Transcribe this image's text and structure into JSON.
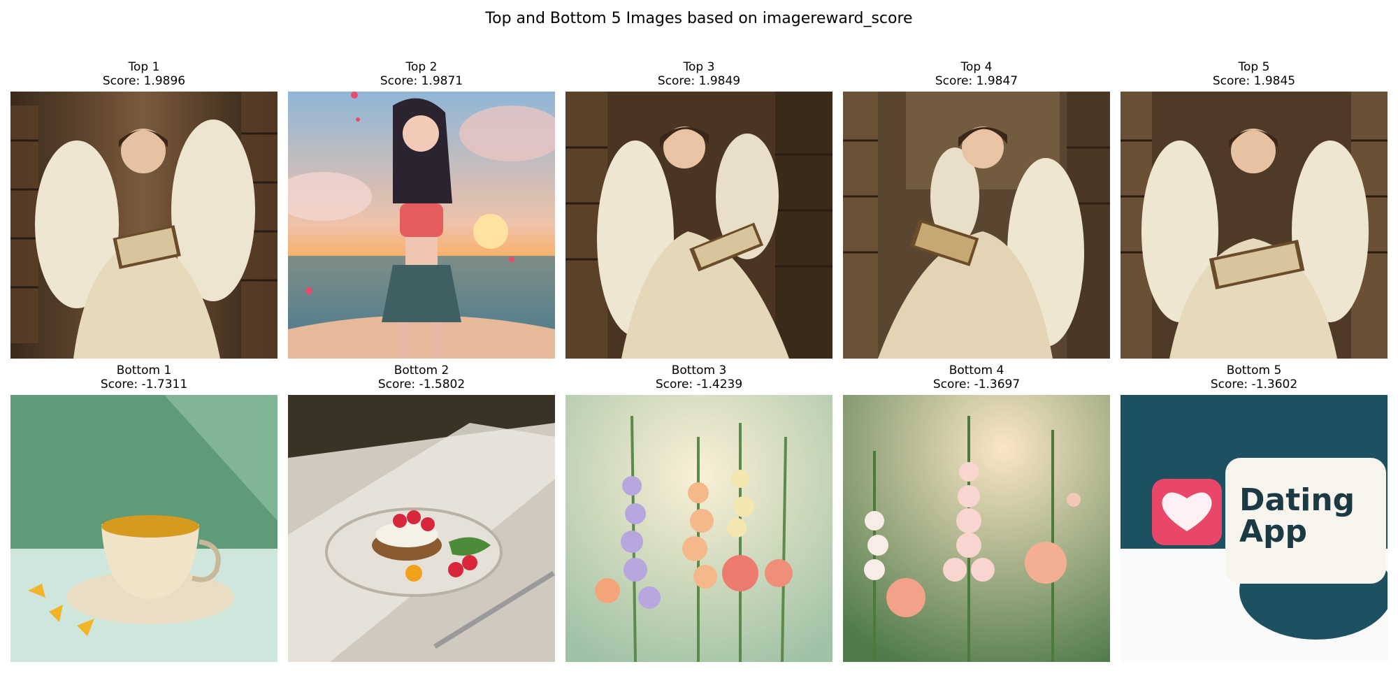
{
  "title": "Top and Bottom 5 Images based on imagereward_score",
  "top": [
    {
      "label": "Top 1",
      "score": "Score: 1.9896",
      "image": "angel-reading-library"
    },
    {
      "label": "Top 2",
      "score": "Score: 1.9871",
      "image": "girl-on-beach-sunset"
    },
    {
      "label": "Top 3",
      "score": "Score: 1.9849",
      "image": "angel-reading-library"
    },
    {
      "label": "Top 4",
      "score": "Score: 1.9847",
      "image": "angel-reading-library"
    },
    {
      "label": "Top 5",
      "score": "Score: 1.9845",
      "image": "angel-reading-library"
    }
  ],
  "bottom": [
    {
      "label": "Bottom 1",
      "score": "Score: -1.7311",
      "image": "tea-cup-on-green"
    },
    {
      "label": "Bottom 2",
      "score": "Score: -1.5802",
      "image": "breakfast-plate"
    },
    {
      "label": "Bottom 3",
      "score": "Score: -1.4239",
      "image": "flowers-field"
    },
    {
      "label": "Bottom 4",
      "score": "Score: -1.3697",
      "image": "flowers-field"
    },
    {
      "label": "Bottom 5",
      "score": "Score: -1.3602",
      "image": "dating-app-logo",
      "text": [
        "Dating",
        "App"
      ]
    }
  ]
}
